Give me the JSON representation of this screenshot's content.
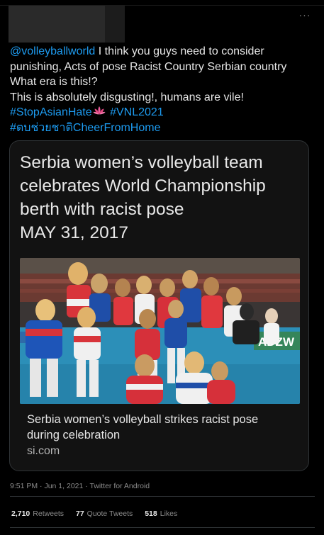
{
  "tweet": {
    "more_icon_glyph": "···",
    "mention": "@volleyballworld",
    "line1_rest": " I think you guys need to consider",
    "line2": "punishing, Acts of pose Racist Country Serbian country",
    "line3": "What era is this!?",
    "line4": "This is absolutely disgusting!, humans are vile!",
    "hashtag1": "#StopAsianHate",
    "hashtag2": "#VNL2021",
    "hashtag3": "#ตบช่วยชาติCheerFromHome",
    "emoji_icon": "lotus-icon"
  },
  "card": {
    "headline_lines": [
      "Serbia women’s volleyball team",
      "celebrates World Championship",
      "berth with racist pose",
      "MAY 31, 2017"
    ],
    "photo_banner_text": "ADZW",
    "title_lines": [
      "Serbia women’s volleyball strikes racist pose",
      "during celebration"
    ],
    "domain": "si.com"
  },
  "meta": {
    "time": "9:51 PM",
    "sep": " · ",
    "date": "Jun 1, 2021",
    "source": "Twitter for Android"
  },
  "stats": {
    "retweets_count": "2,710",
    "retweets_label": "Retweets",
    "quotes_count": "77",
    "quotes_label": "Quote Tweets",
    "likes_count": "518",
    "likes_label": "Likes"
  },
  "colors": {
    "background": "#000000",
    "link": "#1d9bf0",
    "text": "#e6e6e6",
    "muted": "#8b8b8b",
    "border": "#2f3336"
  }
}
